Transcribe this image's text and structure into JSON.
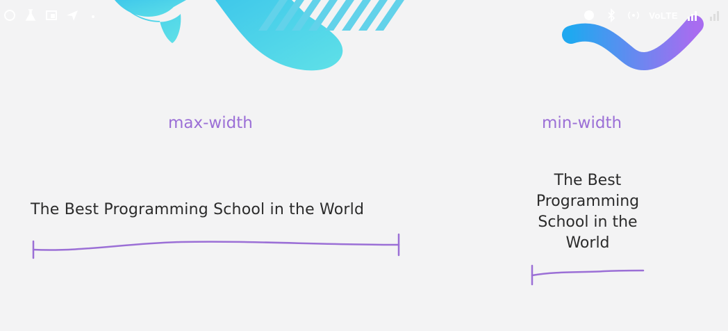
{
  "slide": {
    "max_width_label": "max-width",
    "min_width_label": "min-width",
    "wide_text": "The Best Programming School in the World",
    "narrow_text": "The Best Programming School in the World"
  },
  "status_bar": {
    "left_icons": [
      "circle-icon",
      "flask-icon",
      "cast-icon",
      "send-icon",
      "dot-icon"
    ],
    "right_icons": [
      "alarm-icon",
      "bluetooth-icon",
      "hotspot-icon",
      "volte-icon",
      "signal-icon",
      "signal-icon"
    ],
    "volte_text": "VoLTE"
  },
  "colors": {
    "accent": "#9b6fd6",
    "text": "#2b2b2b",
    "background": "#f3f3f4",
    "gradient_start": "#3fd2e6",
    "gradient_end": "#a86cf0"
  }
}
